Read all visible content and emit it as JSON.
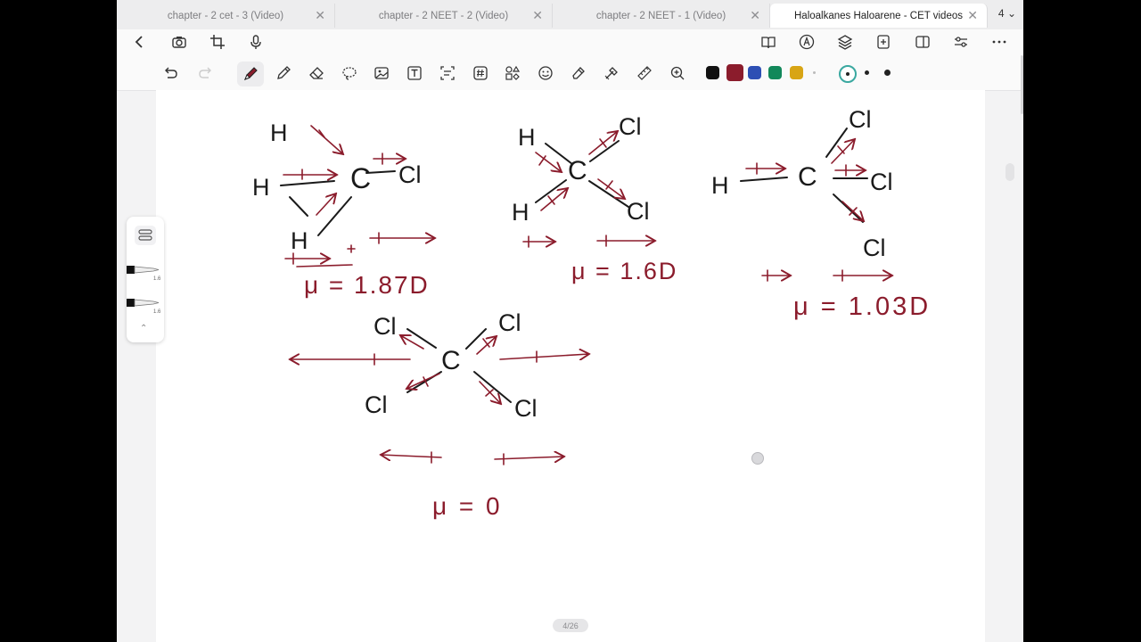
{
  "tabs": [
    {
      "label": "chapter - 2 cet - 3 (Video)",
      "active": false
    },
    {
      "label": "chapter - 2 NEET - 2 (Video)",
      "active": false
    },
    {
      "label": "chapter - 2 NEET - 1 (Video)",
      "active": false
    },
    {
      "label": "Haloalkanes Haloarene - CET videos",
      "active": true
    }
  ],
  "tab_count": "4",
  "nav_left_icons": [
    "back-icon",
    "camera-icon",
    "crop-icon",
    "microphone-icon"
  ],
  "nav_right_icons": [
    "book-icon",
    "pencil-circle-icon",
    "layers-icon",
    "page-add-icon",
    "sidebar-icon",
    "sliders-icon",
    "more-icon"
  ],
  "tools": [
    "undo-icon",
    "redo-icon",
    "pen-icon",
    "pencil-icon",
    "eraser-icon",
    "lasso-icon",
    "image-icon",
    "text-icon",
    "ocr-icon",
    "hashtag-icon",
    "shapes-icon",
    "sticker-icon",
    "highlighter-icon",
    "laser-icon",
    "ruler-icon",
    "zoom-icon"
  ],
  "colors": {
    "black": "#111111",
    "maroon": "#8b1c2c",
    "blue": "#2d4fb4",
    "green": "#12885a",
    "yellow": "#d8a515",
    "ink": "#1a1a1a"
  },
  "pen_panel": {
    "size1": "1.6",
    "size2": "1.6"
  },
  "page_indicator": "4/26",
  "notes": {
    "mol1": {
      "atoms": [
        "H",
        "H",
        "H",
        "C",
        "Cl"
      ],
      "dipole": "μ = 1.87D"
    },
    "mol2": {
      "atoms": [
        "H",
        "H",
        "C",
        "Cl",
        "Cl"
      ],
      "dipole": "μ = 1.6D"
    },
    "mol3": {
      "atoms": [
        "H",
        "C",
        "Cl",
        "Cl",
        "Cl"
      ],
      "dipole": "μ = 1.03D"
    },
    "mol4": {
      "atoms": [
        "Cl",
        "Cl",
        "Cl",
        "Cl",
        "C"
      ],
      "dipole": "μ = 0"
    }
  }
}
